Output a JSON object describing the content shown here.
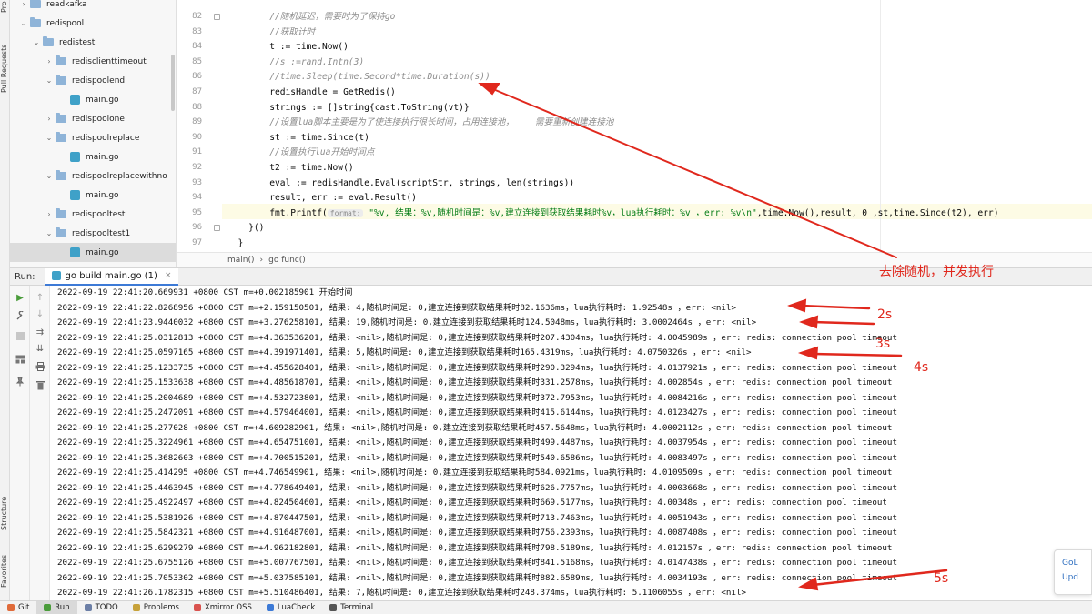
{
  "side_strip": {
    "top_tab": "Pro",
    "pull_requests": "Pull Requests",
    "structure": "Structure",
    "favorites": "Favorites"
  },
  "tree": {
    "items": [
      {
        "label": "readkafka",
        "kind": "folder",
        "expanded": false,
        "depth": 1
      },
      {
        "label": "redispool",
        "kind": "folder",
        "expanded": true,
        "depth": 1
      },
      {
        "label": "redistest",
        "kind": "folder",
        "expanded": true,
        "depth": 2
      },
      {
        "label": "redisclienttimeout",
        "kind": "folder",
        "expanded": false,
        "depth": 3
      },
      {
        "label": "redispoolend",
        "kind": "folder",
        "expanded": true,
        "depth": 3
      },
      {
        "label": "main.go",
        "kind": "file",
        "depth": 4
      },
      {
        "label": "redispoolone",
        "kind": "folder",
        "expanded": false,
        "depth": 3
      },
      {
        "label": "redispoolreplace",
        "kind": "folder",
        "expanded": true,
        "depth": 3
      },
      {
        "label": "main.go",
        "kind": "file",
        "depth": 4
      },
      {
        "label": "redispoolreplacewithno",
        "kind": "folder",
        "expanded": true,
        "depth": 3
      },
      {
        "label": "main.go",
        "kind": "file",
        "depth": 4
      },
      {
        "label": "redispooltest",
        "kind": "folder",
        "expanded": false,
        "depth": 3
      },
      {
        "label": "redispooltest1",
        "kind": "folder",
        "expanded": true,
        "depth": 3
      },
      {
        "label": "main.go",
        "kind": "file",
        "depth": 4,
        "selected": true
      }
    ]
  },
  "editor": {
    "lines": [
      {
        "num": "82",
        "text": "        //随机延迟，需要时为了保持go",
        "comment": true
      },
      {
        "num": "83",
        "text": "        //获取计时",
        "comment": true
      },
      {
        "num": "84",
        "text": "        t := time.Now()"
      },
      {
        "num": "85",
        "text": "        //s :=rand.Intn(3)",
        "comment": true
      },
      {
        "num": "86",
        "text": "        //time.Sleep(time.Second*time.Duration(s))",
        "comment": true
      },
      {
        "num": "87",
        "text": "        redisHandle = GetRedis()"
      },
      {
        "num": "88",
        "text": "        strings := []string{cast.ToString(vt)}"
      },
      {
        "num": "89",
        "text": "        //设置lua脚本主要是为了使连接执行很长时间，占用连接池，    需要重新创建连接池",
        "comment": true
      },
      {
        "num": "90",
        "text": "        st := time.Since(t)"
      },
      {
        "num": "91",
        "text": "        //设置执行lua开始时间点",
        "comment": true
      },
      {
        "num": "92",
        "text": "        t2 := time.Now()"
      },
      {
        "num": "93",
        "text": "        eval := redisHandle.Eval(scriptStr, strings, len(strings))"
      },
      {
        "num": "94",
        "text": "        result, err := eval.Result()"
      },
      {
        "num": "95",
        "text": "        fmt.Printf(",
        "hint": "format:",
        "str": " \"%v, 结果：%v,随机时间是：%v,建立连接到获取结果耗时%v，lua执行耗时：%v ，err: %v\\n\"",
        "rest": ",time.Now(),result, 0 ,st,time.Since(t2), err)"
      },
      {
        "num": "96",
        "text": "    }()"
      },
      {
        "num": "97",
        "text": "  }"
      }
    ],
    "breadcrumb": [
      "main()",
      "›",
      "go func()"
    ]
  },
  "run_panel": {
    "label": "Run:",
    "tab": "go build main.go (1)",
    "close": "×"
  },
  "console": {
    "lines": [
      "2022-09-19 22:41:20.669931 +0800 CST m=+0.002185901 开始时间",
      "2022-09-19 22:41:22.8268956 +0800 CST m=+2.159150501, 结果: 4,随机时间是: 0,建立连接到获取结果耗时82.1636ms，lua执行耗时: 1.92548s ，err: <nil>",
      "2022-09-19 22:41:23.9440032 +0800 CST m=+3.276258101, 结果: 19,随机时间是: 0,建立连接到获取结果耗时124.5048ms，lua执行耗时: 3.0002464s ，err: <nil>",
      "2022-09-19 22:41:25.0312813 +0800 CST m=+4.363536201, 结果: <nil>,随机时间是: 0,建立连接到获取结果耗时207.4304ms，lua执行耗时: 4.0045989s ，err: redis: connection pool timeout",
      "2022-09-19 22:41:25.0597165 +0800 CST m=+4.391971401, 结果: 5,随机时间是: 0,建立连接到获取结果耗时165.4319ms，lua执行耗时: 4.0750326s ，err: <nil>",
      "2022-09-19 22:41:25.1233735 +0800 CST m=+4.455628401, 结果: <nil>,随机时间是: 0,建立连接到获取结果耗时290.3294ms，lua执行耗时: 4.0137921s ，err: redis: connection pool timeout",
      "2022-09-19 22:41:25.1533638 +0800 CST m=+4.485618701, 结果: <nil>,随机时间是: 0,建立连接到获取结果耗时331.2578ms，lua执行耗时: 4.002854s ，err: redis: connection pool timeout",
      "2022-09-19 22:41:25.2004689 +0800 CST m=+4.532723801, 结果: <nil>,随机时间是: 0,建立连接到获取结果耗时372.7953ms，lua执行耗时: 4.0084216s ，err: redis: connection pool timeout",
      "2022-09-19 22:41:25.2472091 +0800 CST m=+4.579464001, 结果: <nil>,随机时间是: 0,建立连接到获取结果耗时415.6144ms，lua执行耗时: 4.0123427s ，err: redis: connection pool timeout",
      "2022-09-19 22:41:25.277028 +0800 CST m=+4.609282901, 结果: <nil>,随机时间是: 0,建立连接到获取结果耗时457.5648ms，lua执行耗时: 4.0002112s ，err: redis: connection pool timeout",
      "2022-09-19 22:41:25.3224961 +0800 CST m=+4.654751001, 结果: <nil>,随机时间是: 0,建立连接到获取结果耗时499.4487ms，lua执行耗时: 4.0037954s ，err: redis: connection pool timeout",
      "2022-09-19 22:41:25.3682603 +0800 CST m=+4.700515201, 结果: <nil>,随机时间是: 0,建立连接到获取结果耗时540.6586ms，lua执行耗时: 4.0083497s ，err: redis: connection pool timeout",
      "2022-09-19 22:41:25.414295 +0800 CST m=+4.746549901, 结果: <nil>,随机时间是: 0,建立连接到获取结果耗时584.0921ms，lua执行耗时: 4.0109509s ，err: redis: connection pool timeout",
      "2022-09-19 22:41:25.4463945 +0800 CST m=+4.778649401, 结果: <nil>,随机时间是: 0,建立连接到获取结果耗时626.7757ms，lua执行耗时: 4.0003668s ，err: redis: connection pool timeout",
      "2022-09-19 22:41:25.4922497 +0800 CST m=+4.824504601, 结果: <nil>,随机时间是: 0,建立连接到获取结果耗时669.5177ms，lua执行耗时: 4.00348s ，err: redis: connection pool timeout",
      "2022-09-19 22:41:25.5381926 +0800 CST m=+4.870447501, 结果: <nil>,随机时间是: 0,建立连接到获取结果耗时713.7463ms，lua执行耗时: 4.0051943s ，err: redis: connection pool timeout",
      "2022-09-19 22:41:25.5842321 +0800 CST m=+4.916487001, 结果: <nil>,随机时间是: 0,建立连接到获取结果耗时756.2393ms，lua执行耗时: 4.0087408s ，err: redis: connection pool timeout",
      "2022-09-19 22:41:25.6299279 +0800 CST m=+4.962182801, 结果: <nil>,随机时间是: 0,建立连接到获取结果耗时798.5189ms，lua执行耗时: 4.012157s ，err: redis: connection pool timeout",
      "2022-09-19 22:41:25.6755126 +0800 CST m=+5.007767501, 结果: <nil>,随机时间是: 0,建立连接到获取结果耗时841.5168ms，lua执行耗时: 4.0147438s ，err: redis: connection pool timeout",
      "2022-09-19 22:41:25.7053302 +0800 CST m=+5.037585101, 结果: <nil>,随机时间是: 0,建立连接到获取结果耗时882.6589ms，lua执行耗时: 4.0034193s ，err: redis: connection pool timeout",
      "2022-09-19 22:41:26.1782315 +0800 CST m=+5.510486401, 结果: 7,随机时间是: 0,建立连接到获取结果耗时248.374ms，lua执行耗时: 5.1106055s ，err: <nil>"
    ]
  },
  "annotations": {
    "main_note": "去除随机，并发执行",
    "marks": [
      "2s",
      "3s",
      "4s",
      "5s"
    ],
    "color": "#e0281d"
  },
  "notification": {
    "line1": "GoL",
    "line2": "Upd"
  },
  "bottom_bar": {
    "tabs": [
      {
        "label": "Git",
        "icon": "git-icon",
        "active": false
      },
      {
        "label": "Run",
        "icon": "run-icon",
        "active": true
      },
      {
        "label": "TODO",
        "icon": "todo-icon",
        "active": false
      },
      {
        "label": "Problems",
        "icon": "problems-icon",
        "active": false
      },
      {
        "label": "Xmirror OSS",
        "icon": "xmirror-icon",
        "active": false
      },
      {
        "label": "LuaCheck",
        "icon": "luacheck-icon",
        "active": false
      },
      {
        "label": "Terminal",
        "icon": "terminal-icon",
        "active": false
      }
    ]
  }
}
